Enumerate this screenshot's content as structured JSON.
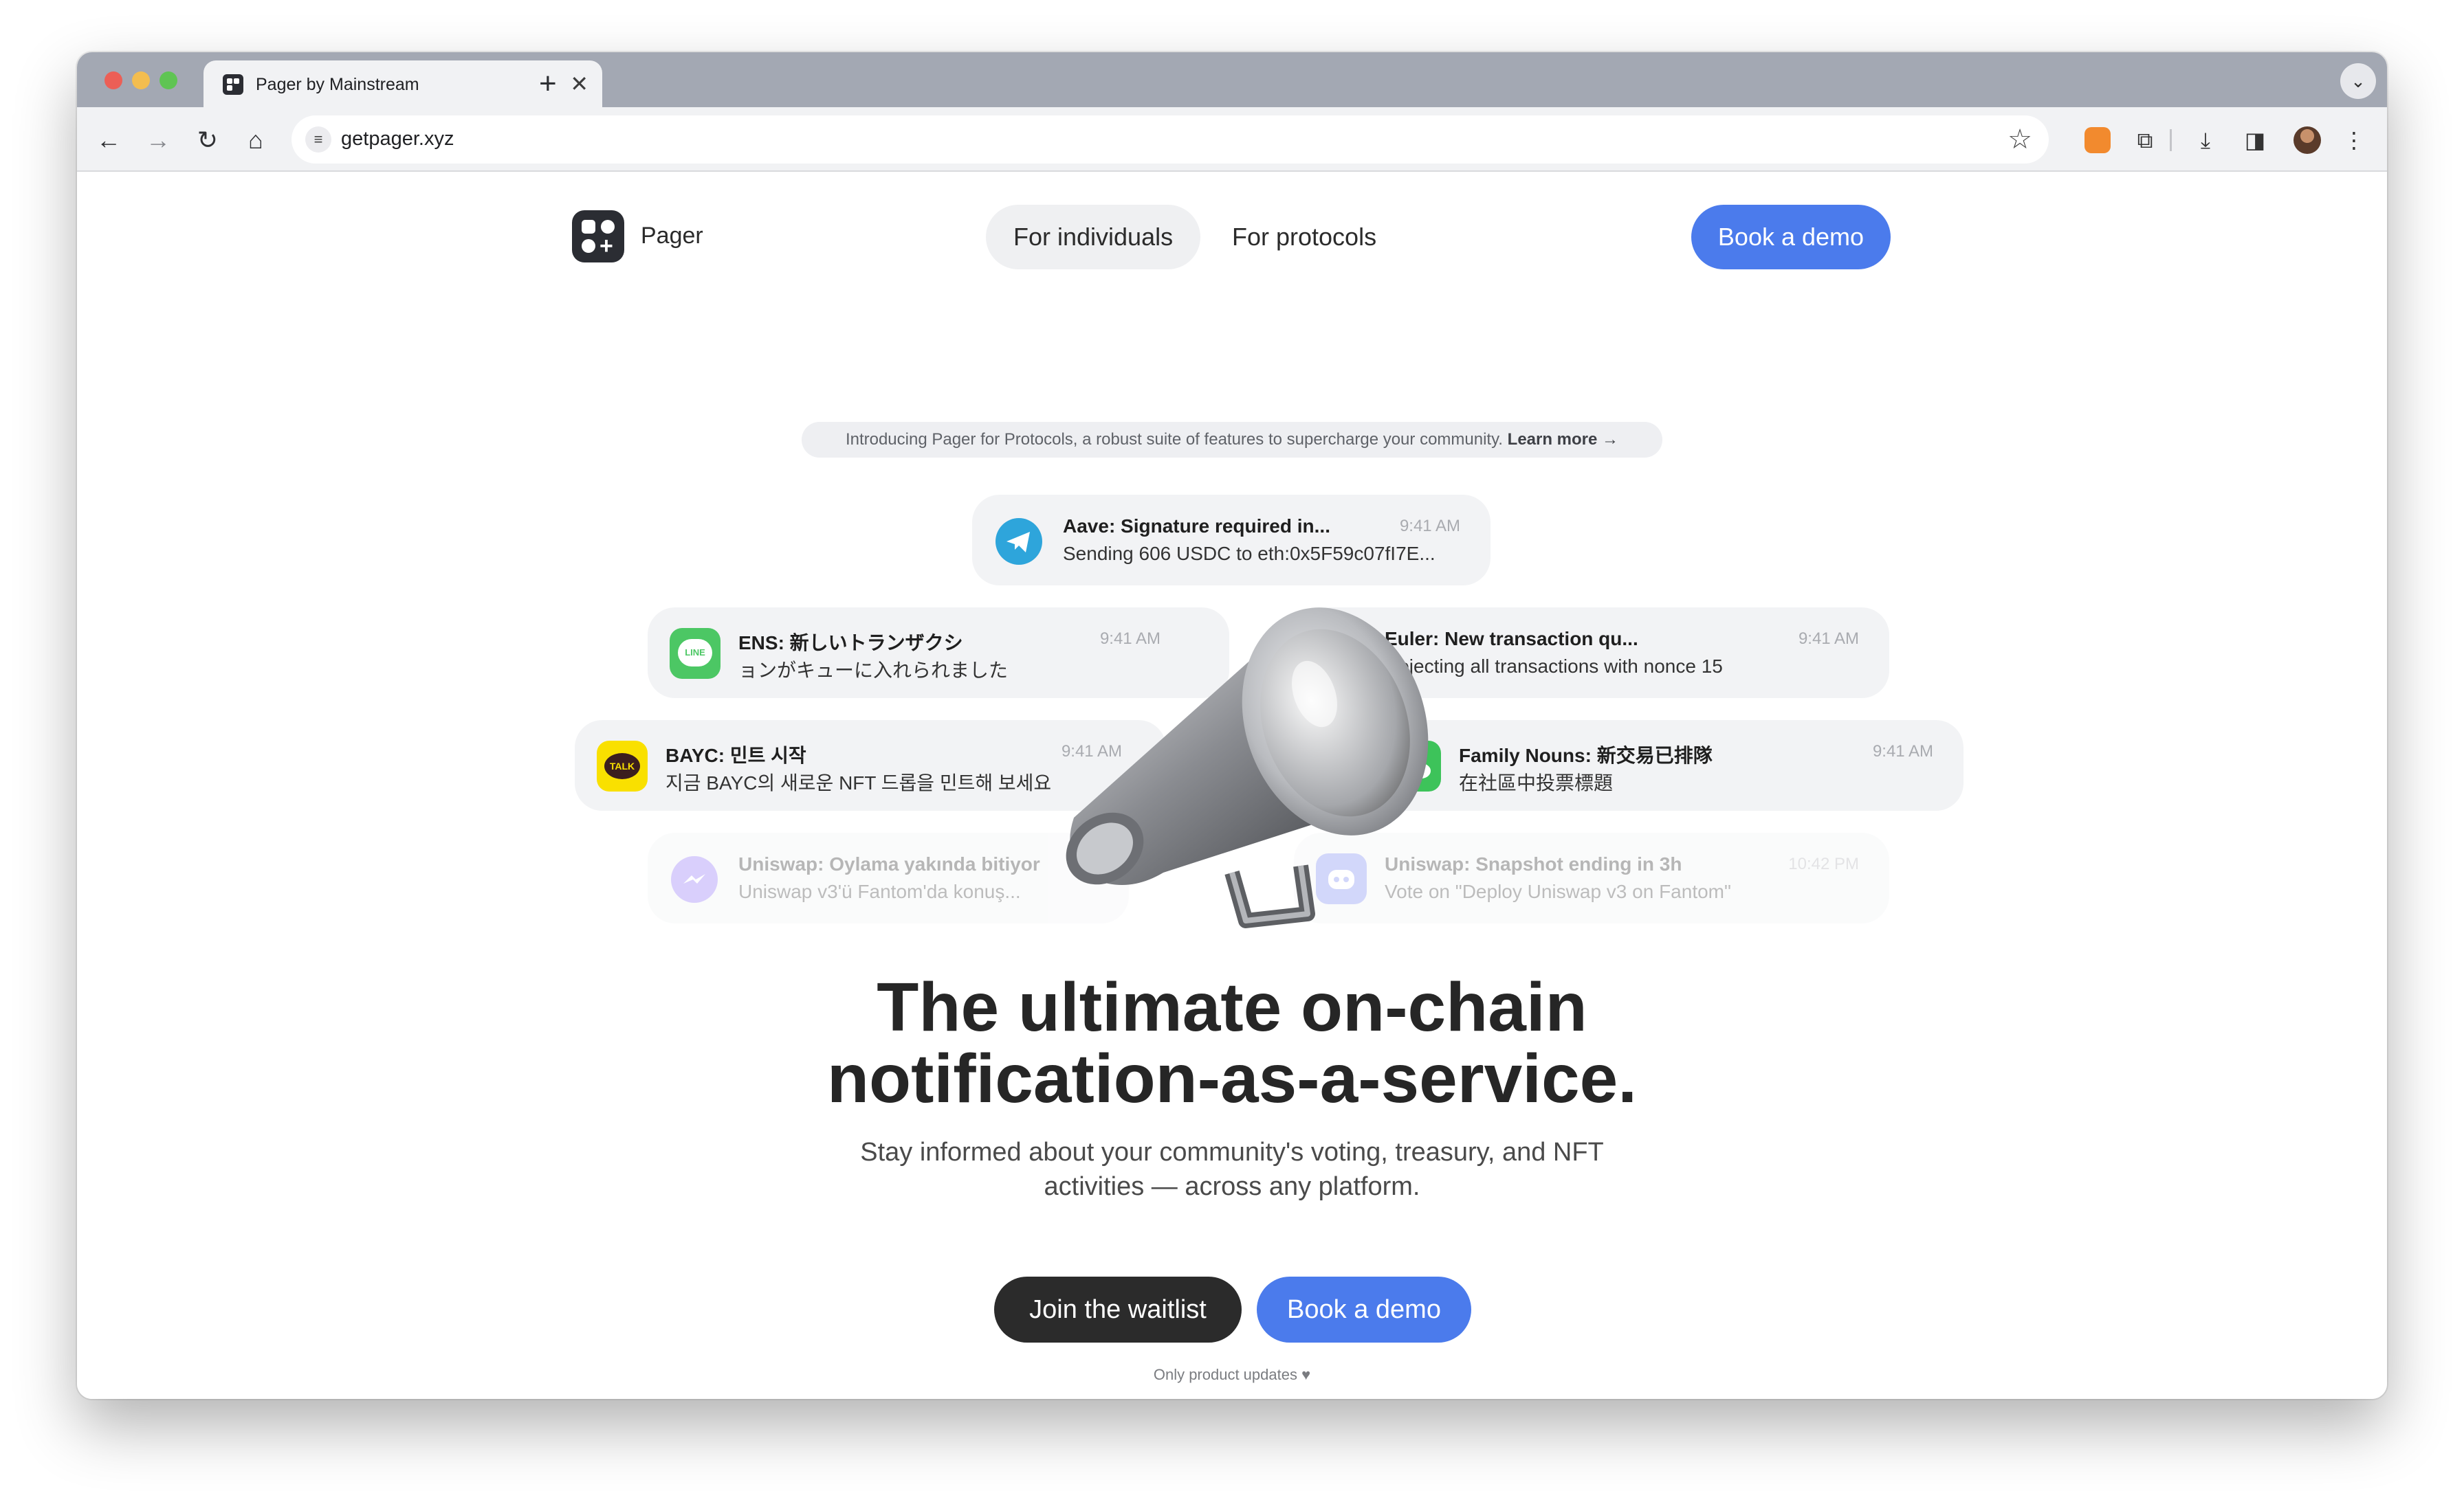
{
  "browser": {
    "tab_title": "Pager by Mainstream",
    "tab_close": "✕",
    "new_tab": "+",
    "url": "getpager.xyz"
  },
  "nav": {
    "brand": "Pager",
    "for_individuals": "For individuals",
    "for_protocols": "For protocols",
    "book_demo": "Book a demo"
  },
  "announcement": {
    "text": "Introducing Pager for Protocols, a robust suite of features to supercharge your community.",
    "link": "Learn more →"
  },
  "notifications": [
    {
      "app": "Telegram",
      "icon": "telegram-icon",
      "title": "Aave: Signature required in...",
      "time": "9:41 AM",
      "body": "Sending 606 USDC to eth:0x5F59c07fI7E..."
    },
    {
      "app": "LINE",
      "icon": "line-icon",
      "icon_text": "LINE",
      "title": "ENS: 新しいトランザクシ",
      "time": "9:41 AM",
      "body": "ョンがキューに入れられました"
    },
    {
      "app": "Mail",
      "icon": "mail-icon",
      "title": "Euler: New transaction qu...",
      "time": "9:41 AM",
      "body": "Rejecting all transactions with nonce 15"
    },
    {
      "app": "KakaoTalk",
      "icon": "kakaotalk-icon",
      "icon_text": "TALK",
      "title": "BAYC: 민트 시작",
      "time": "9:41 AM",
      "body": "지금 BAYC의 새로운 NFT 드롭을 민트해 보세요"
    },
    {
      "app": "WeChat",
      "icon": "wechat-icon",
      "title": "Family Nouns: 新交易已排隊",
      "time": "9:41 AM",
      "body": "在社區中投票標題"
    },
    {
      "app": "Messenger",
      "icon": "messenger-icon",
      "title": "Uniswap: Oylama yakında bitiyor",
      "time": "",
      "body": "Uniswap v3'ü Fantom'da konuş..."
    },
    {
      "app": "Discord",
      "icon": "discord-icon",
      "title": "Uniswap: Snapshot ending in 3h",
      "time": "10:42 PM",
      "body": "Vote on \"Deploy Uniswap v3 on Fantom\""
    }
  ],
  "hero": {
    "headline_line1": "The ultimate on-chain",
    "headline_line2": "notification-as-a-service.",
    "sub_line1": "Stay informed about your community's voting, treasury, and NFT",
    "sub_line2": "activities — across any platform.",
    "join_waitlist": "Join the waitlist",
    "book_demo": "Book a demo",
    "footnote": "Only product updates ♥"
  },
  "colors": {
    "accent_blue": "#4b7bec",
    "dark_button": "#2b2b2b",
    "telegram": "#2ea5db",
    "line": "#4cc764",
    "mail": "#3d8cf0",
    "kakaotalk": "#f9e000",
    "wechat": "#3dc35a",
    "messenger": "#8b6cf6",
    "discord": "#7785f0"
  }
}
